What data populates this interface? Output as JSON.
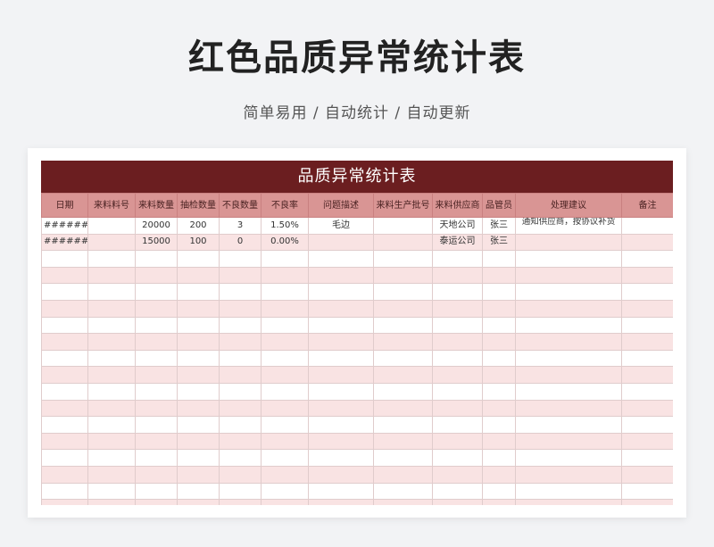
{
  "header": {
    "title": "红色品质异常统计表",
    "subtitle": "简单易用 / 自动统计 / 自动更新"
  },
  "sheet": {
    "title": "品质异常统计表",
    "columns": [
      "日期",
      "来料料号",
      "来料数量",
      "抽检数量",
      "不良数量",
      "不良率",
      "问题描述",
      "来料生产批号",
      "来料供应商",
      "品管员",
      "处理建议",
      "备注"
    ],
    "rows": [
      [
        "########",
        "",
        "20000",
        "200",
        "3",
        "1.50%",
        "毛边",
        "",
        "天地公司",
        "张三",
        "通知供应商，按协议补货",
        ""
      ],
      [
        "########",
        "",
        "15000",
        "100",
        "0",
        "0.00%",
        "",
        "",
        "泰运公司",
        "张三",
        "",
        ""
      ]
    ],
    "empty_row_count": 16
  },
  "colors": {
    "title_bar": "#6b1e20",
    "header_fill": "#d99594",
    "stripe": "#f9e3e3"
  }
}
